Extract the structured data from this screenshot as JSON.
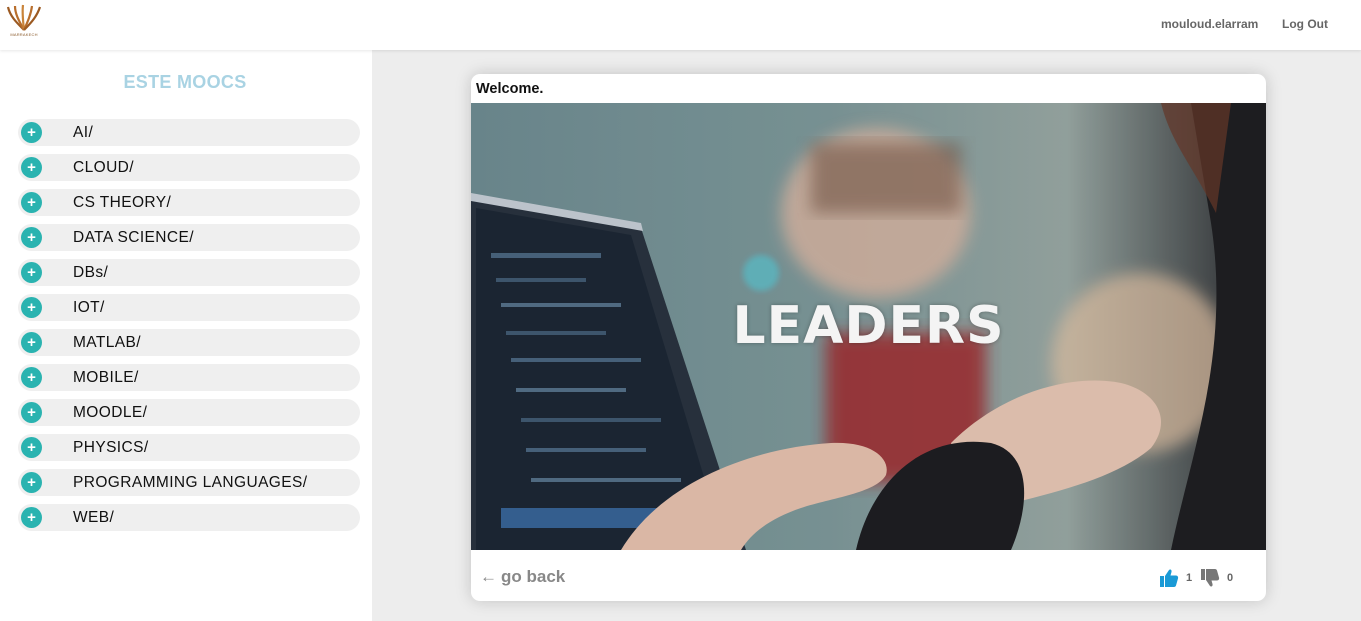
{
  "header": {
    "logo_text": "MARRAKECH",
    "username": "mouloud.elarram",
    "logout_label": "Log Out"
  },
  "sidebar": {
    "title": "ESTE MOOCS",
    "categories": [
      {
        "label": "AI/"
      },
      {
        "label": "CLOUD/"
      },
      {
        "label": "CS THEORY/"
      },
      {
        "label": "DATA SCIENCE/"
      },
      {
        "label": "DBs/"
      },
      {
        "label": "IOT/"
      },
      {
        "label": "MATLAB/"
      },
      {
        "label": "MOBILE/"
      },
      {
        "label": "MOODLE/"
      },
      {
        "label": "PHYSICS/"
      },
      {
        "label": "PROGRAMMING LANGUAGES/"
      },
      {
        "label": "WEB/"
      }
    ],
    "item_icon": "plus-icon"
  },
  "main": {
    "card_title": "Welcome.",
    "video_overlay_text": "LEADERS",
    "go_back_arrow": "←",
    "go_back_label": "go back",
    "likes": "1",
    "dislikes": "0"
  },
  "colors": {
    "accent_teal": "#2ab3b0",
    "title_light_blue": "#a9d3e3",
    "like_blue": "#1a9ad6",
    "dislike_gray": "#777777"
  }
}
